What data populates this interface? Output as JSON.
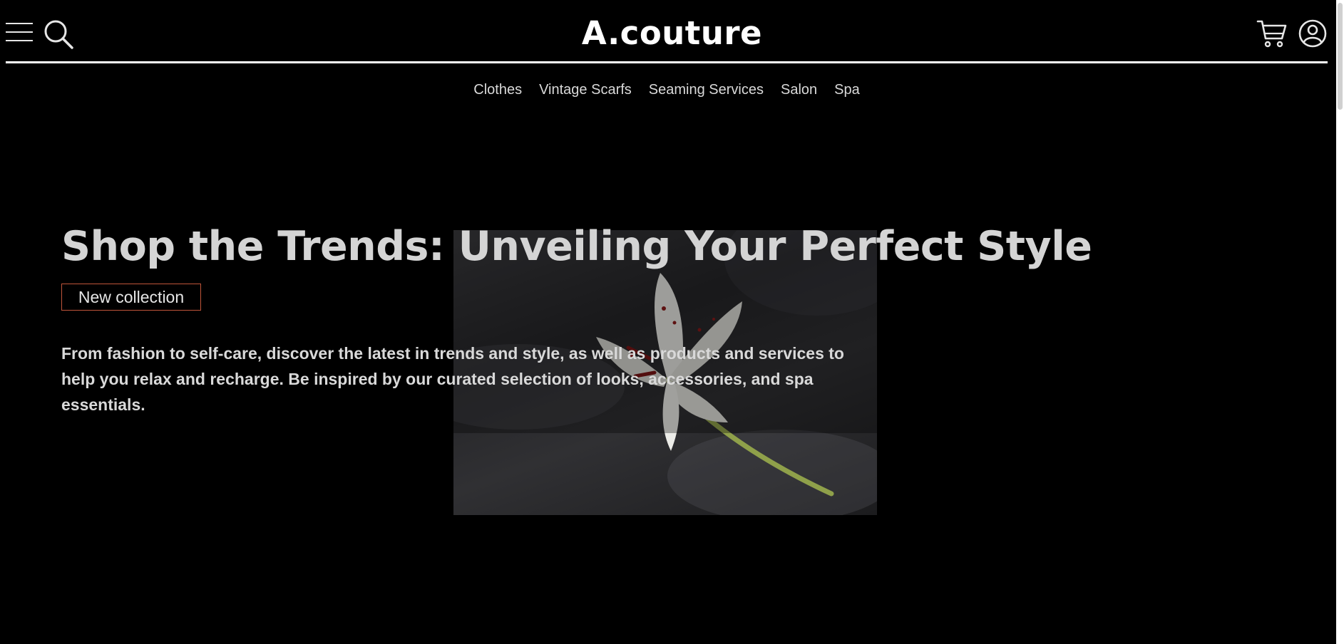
{
  "header": {
    "brand": "A.couture",
    "menu_icon": "hamburger-menu-icon",
    "search_icon": "search-icon",
    "cart_icon": "shopping-cart-icon",
    "account_icon": "user-account-icon"
  },
  "nav": {
    "items": [
      {
        "label": "Clothes"
      },
      {
        "label": "Vintage Scarfs"
      },
      {
        "label": "Seaming Services"
      },
      {
        "label": "Salon"
      },
      {
        "label": "Spa"
      }
    ]
  },
  "hero": {
    "title": "Shop the Trends: Unveiling Your Perfect Style",
    "badge": "New collection",
    "description": "From fashion to self-care, discover the latest in trends and style, as well as products and services to help you relax and recharge. Be inspired by our curated selection of looks, accessories, and spa essentials.",
    "image_icon": "white-lily-on-black-fabric-image"
  },
  "colors": {
    "background": "#000000",
    "text": "#ffffff",
    "badge_border": "#c0553a"
  }
}
